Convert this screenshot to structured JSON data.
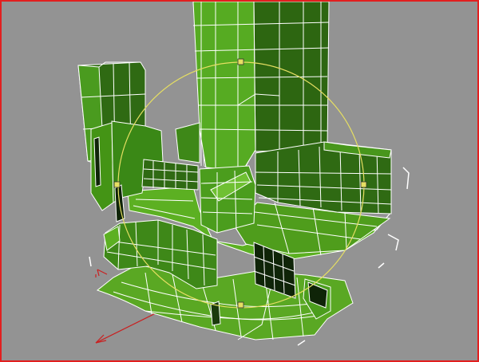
{
  "viewport": {
    "label": "",
    "active": true,
    "background_color": "#939393",
    "active_border_color": "#e21f1f",
    "mesh": {
      "face_color_light": "#5fb324",
      "face_color_mid": "#3f8a18",
      "face_color_dark": "#2b5f10",
      "wire_color": "#ffffff"
    },
    "rotate_gizmo": {
      "ring_color": "#e8e060",
      "handle_icon": "square-handle"
    },
    "bounding_box_color": "#ffffff",
    "axis_tripod_color": "#cc2020"
  }
}
